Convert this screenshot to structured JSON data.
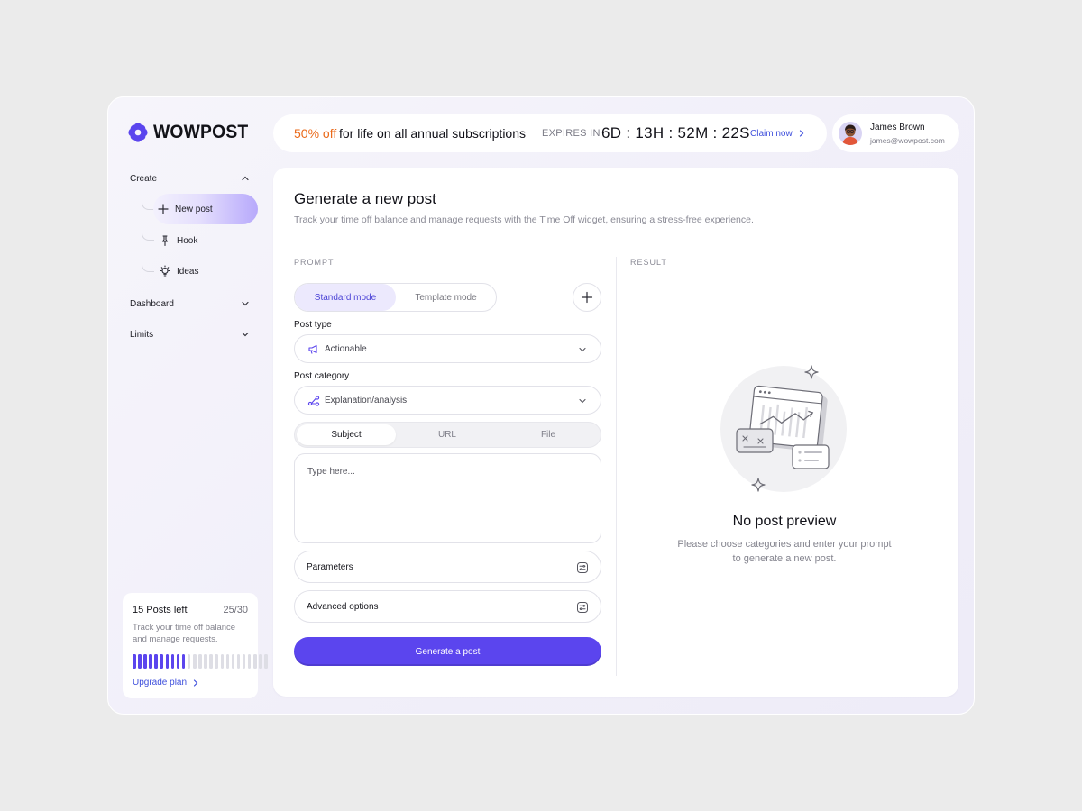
{
  "app": {
    "brand": "WOWPOST"
  },
  "sidebar": {
    "create_label": "Create",
    "sub_items": [
      {
        "label": "New post",
        "icon": "plus-icon"
      },
      {
        "label": "Hook",
        "icon": "pin-icon"
      },
      {
        "label": "Ideas",
        "icon": "lightbulb-icon"
      }
    ],
    "dashboard_label": "Dashboard",
    "limits_label": "Limits"
  },
  "promo": {
    "discount": "50% off",
    "rest": "for life on all annual subscriptions",
    "expires_label": "EXPIRES IN",
    "countdown": "6D : 13H : 52M : 22S",
    "claim_label": "Claim now"
  },
  "user": {
    "name": "James Brown",
    "email": "james@wowpost.com"
  },
  "main": {
    "title": "Generate a new post",
    "subtitle": "Track your time off balance and manage requests with the Time Off widget, ensuring a stress-free experience.",
    "prompt_label": "PROMPT",
    "result_label": "RESULT",
    "modes": {
      "standard": "Standard mode",
      "template": "Template mode"
    },
    "post_type_label": "Post type",
    "post_type_value": "Actionable",
    "post_category_label": "Post category",
    "post_category_value": "Explanation/analysis",
    "tabs": [
      "Subject",
      "URL",
      "File"
    ],
    "textarea_placeholder": "Type here...",
    "parameters_label": "Parameters",
    "advanced_label": "Advanced options",
    "generate_label": "Generate a post",
    "empty_title": "No post preview",
    "empty_desc": "Please choose categories and enter your prompt to generate a new post."
  },
  "posts_card": {
    "title": "15 Posts left",
    "count": "25/30",
    "desc": "Track your time off balance and manage requests.",
    "used": 10,
    "total": 25,
    "upgrade_label": "Upgrade plan"
  },
  "colors": {
    "accent": "#5b45ee",
    "promo": "#ea6a1a",
    "link": "#3f50dc"
  }
}
